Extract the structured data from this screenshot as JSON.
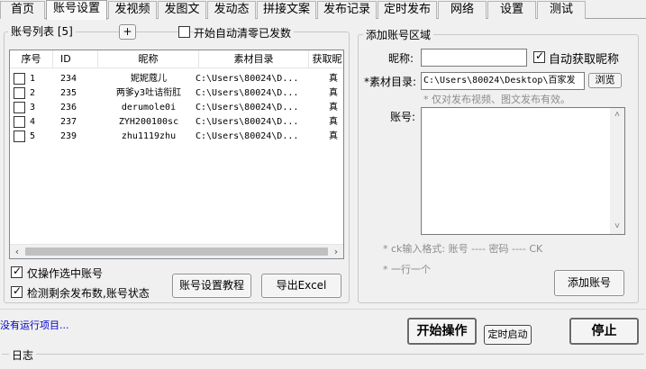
{
  "tabs": [
    "首页",
    "账号设置",
    "发视频",
    "发图文",
    "发动态",
    "拼接文案",
    "发布记录",
    "定时发布",
    "网络",
    "设置",
    "测试"
  ],
  "account_list": {
    "title": "账号列表 [5]",
    "add_symbol": "+",
    "auto_clear_label": "开始自动清零已发数",
    "columns": [
      "序号",
      "ID",
      "昵称",
      "素材目录",
      "获取昵"
    ],
    "rows": [
      {
        "index": "1",
        "id": "234",
        "nickname": "妮妮蔻儿",
        "dir": "C:\\Users\\80024\\D...",
        "fetch": "真"
      },
      {
        "index": "2",
        "id": "235",
        "nickname": "两爹y3吐诘衔肛",
        "dir": "C:\\Users\\80024\\D...",
        "fetch": "真"
      },
      {
        "index": "3",
        "id": "236",
        "nickname": "derumole0i",
        "dir": "C:\\Users\\80024\\D...",
        "fetch": "真"
      },
      {
        "index": "4",
        "id": "237",
        "nickname": "ZYH200100sc",
        "dir": "C:\\Users\\80024\\D...",
        "fetch": "真"
      },
      {
        "index": "5",
        "id": "239",
        "nickname": "zhu1119zhu",
        "dir": "C:\\Users\\80024\\D...",
        "fetch": "真"
      }
    ],
    "only_selected_label": "仅操作选中账号",
    "check_remaining_label": "检测剩余发布数,账号状态",
    "tutorial_button": "账号设置教程",
    "export_button": "导出Excel"
  },
  "add_account": {
    "title": "添加账号区域",
    "nickname_label": "昵称:",
    "nickname_value": "",
    "auto_nickname_label": "自动获取昵称",
    "material_label": "*素材目录:",
    "material_value": "C:\\Users\\80024\\Desktop\\百家发",
    "browse_button": "浏览",
    "material_hint": "* 仅对发布视频、图文发布有效。",
    "account_label": "账号:",
    "account_value": "",
    "format_hint": "* ck输入格式: 账号 ---- 密码 ---- CK",
    "line_hint": "* 一行一个",
    "add_button": "添加账号"
  },
  "status_text": "没有运行项目...",
  "start_button": "开始操作",
  "timer_button": "定时启动",
  "stop_button": "停止",
  "log_title": "日志"
}
